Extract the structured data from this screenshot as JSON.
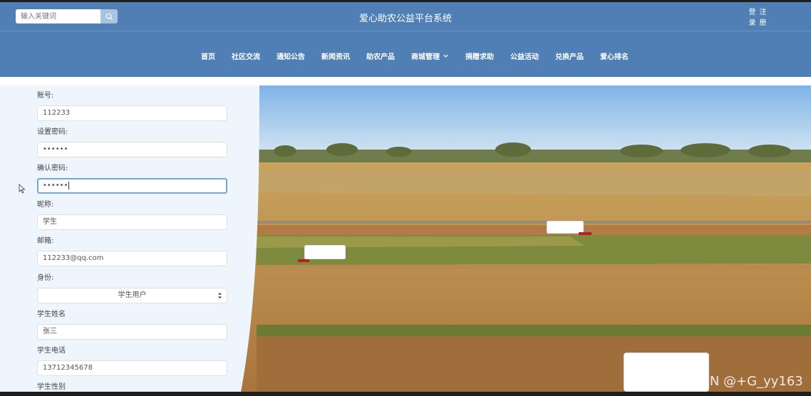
{
  "header": {
    "search_placeholder": "输入关键词",
    "title": "爱心助农公益平台系统",
    "login_label": "登录",
    "register_label": "注册"
  },
  "nav": {
    "items": [
      {
        "label": "首页"
      },
      {
        "label": "社区交流"
      },
      {
        "label": "通知公告"
      },
      {
        "label": "新闻资讯"
      },
      {
        "label": "助农产品"
      },
      {
        "label": "商城管理",
        "dropdown": true
      },
      {
        "label": "捐赠求助"
      },
      {
        "label": "公益活动"
      },
      {
        "label": "兑换产品"
      },
      {
        "label": "爱心排名"
      }
    ]
  },
  "form": {
    "fields": [
      {
        "label": "账号:",
        "value": "112233"
      },
      {
        "label": "设置密码:",
        "value": "••••••"
      },
      {
        "label": "确认密码:",
        "value": "••••••",
        "focused": true
      },
      {
        "label": "昵称:",
        "value": "学生"
      },
      {
        "label": "邮箱:",
        "value": "112233@qq.com"
      },
      {
        "label": "身份:",
        "value": "学生用户",
        "type": "select"
      },
      {
        "label": "学生姓名",
        "value": "张三"
      },
      {
        "label": "学生电话",
        "value": "13712345678"
      },
      {
        "label": "学生性别",
        "value": ""
      }
    ]
  },
  "watermark": "CSDN @+G_yy163",
  "colors": {
    "header_bg": "#4f7fb5",
    "panel_bg": "#eef5fd",
    "focus_border": "#7aa6d6"
  },
  "icons": {
    "search": "search-icon",
    "dropdown": "chevron-down-icon",
    "cursor": "mouse-pointer-icon"
  }
}
